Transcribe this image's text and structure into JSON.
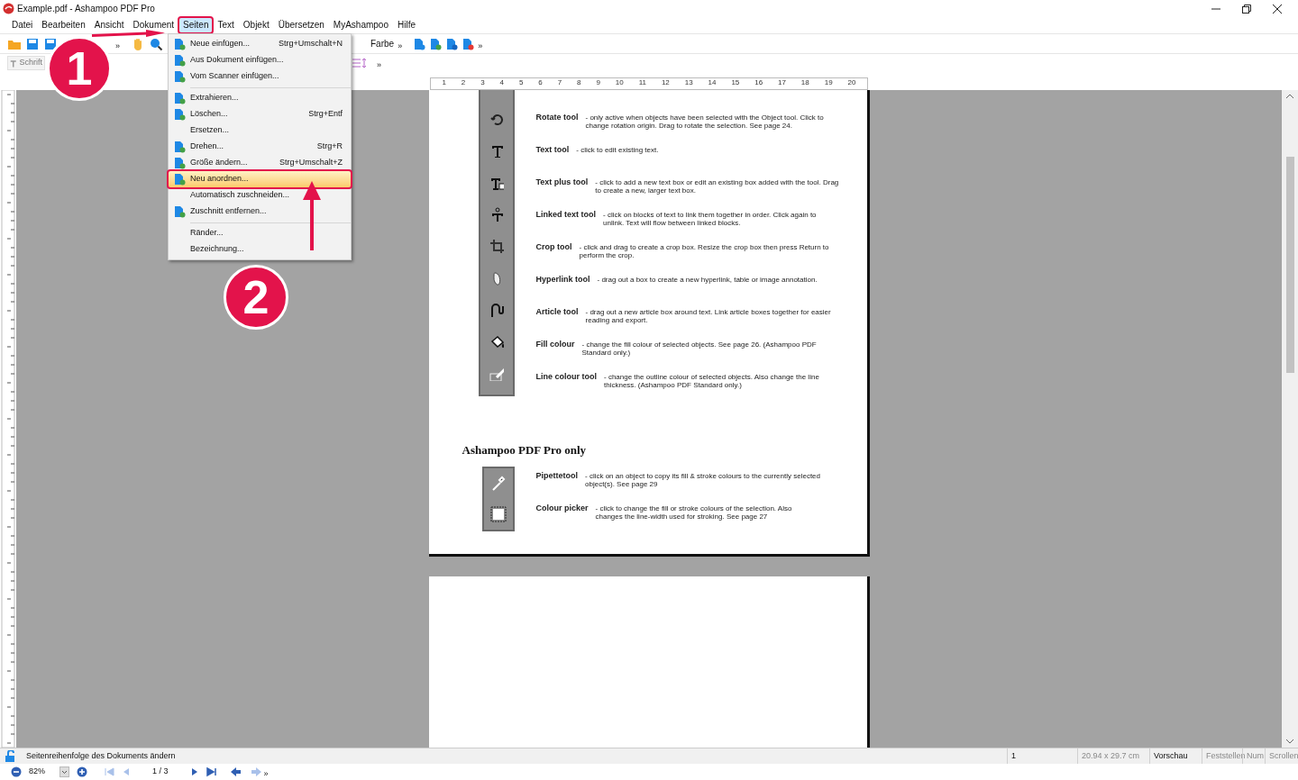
{
  "window": {
    "title": "Example.pdf - Ashampoo PDF Pro"
  },
  "menu_bar": [
    {
      "label": "Datei",
      "selected": false
    },
    {
      "label": "Bearbeiten",
      "selected": false
    },
    {
      "label": "Ansicht",
      "selected": false
    },
    {
      "label": "Dokument",
      "selected": false
    },
    {
      "label": "Seiten",
      "selected": true
    },
    {
      "label": "Text",
      "selected": false
    },
    {
      "label": "Objekt",
      "selected": false
    },
    {
      "label": "Übersetzen",
      "selected": false
    },
    {
      "label": "MyAshampoo",
      "selected": false
    },
    {
      "label": "Hilfe",
      "selected": false
    }
  ],
  "toolbar_1": {
    "chevrons": [
      "»",
      "»",
      "»"
    ],
    "color_label": "Farbe"
  },
  "toolbar_2": {
    "font_field": "Schrift",
    "chevron": "»"
  },
  "dropdown_menu": [
    {
      "kind": "item",
      "label": "Neue einfügen...",
      "shortcut": "Strg+Umschalt+N",
      "icon": true,
      "highlighted": false
    },
    {
      "kind": "item",
      "label": "Aus Dokument einfügen...",
      "icon": true,
      "highlighted": false
    },
    {
      "kind": "item",
      "label": "Vom Scanner einfügen...",
      "icon": true,
      "highlighted": false
    },
    {
      "kind": "separator"
    },
    {
      "kind": "item",
      "label": "Extrahieren...",
      "icon": true,
      "highlighted": false
    },
    {
      "kind": "item",
      "label": "Löschen...",
      "shortcut": "Strg+Entf",
      "icon": true,
      "highlighted": false
    },
    {
      "kind": "item",
      "label": "Ersetzen...",
      "icon": false,
      "highlighted": false
    },
    {
      "kind": "item",
      "label": "Drehen...",
      "shortcut": "Strg+R",
      "icon": true,
      "highlighted": false
    },
    {
      "kind": "item",
      "label": "Größe ändern...",
      "shortcut": "Strg+Umschalt+Z",
      "icon": true,
      "highlighted": false
    },
    {
      "kind": "item",
      "label": "Neu anordnen...",
      "icon": true,
      "highlighted": true
    },
    {
      "kind": "item",
      "label": "Automatisch zuschneiden...",
      "icon": false,
      "highlighted": false
    },
    {
      "kind": "item",
      "label": "Zuschnitt entfernen...",
      "icon": true,
      "highlighted": false
    },
    {
      "kind": "separator"
    },
    {
      "kind": "item",
      "label": "Ränder...",
      "icon": false,
      "highlighted": false
    },
    {
      "kind": "item",
      "label": "Bezeichnung...",
      "icon": false,
      "highlighted": false
    }
  ],
  "annotations": [
    {
      "kind": "circle",
      "number": "1"
    },
    {
      "kind": "arrow"
    },
    {
      "kind": "circle",
      "number": "2"
    },
    {
      "kind": "arrow"
    }
  ],
  "ruler": {
    "labels": [
      "1",
      "2",
      "3",
      "4",
      "5",
      "6",
      "7",
      "8",
      "9",
      "10",
      "11",
      "12",
      "13",
      "14",
      "15",
      "16",
      "17",
      "18",
      "19",
      "20"
    ]
  },
  "document": {
    "tools": [
      {
        "name": "Rotate tool",
        "description": "- only active when objects have been selected with the Object tool. Click to change rotation origin. Drag to rotate the selection. See page 24."
      },
      {
        "name": "Text tool",
        "description": "- click to edit existing text."
      },
      {
        "name": "Text plus tool",
        "description": "- click to add a new text box or edit an existing box added with the tool. Drag to create a new, larger text box."
      },
      {
        "name": "Linked text tool",
        "description": "- click on blocks of text to link them together in order. Click again to unlink. Text will flow between linked blocks."
      },
      {
        "name": "Crop tool",
        "description": "- click and drag to create a crop box. Resize the crop box then press Return to perform the crop."
      },
      {
        "name": "Hyperlink tool",
        "description": "- drag out a box to create a new hyperlink, table or image annotation."
      },
      {
        "name": "Article tool",
        "description": "- drag out a new article box around text. Link article boxes together for easier reading and export."
      },
      {
        "name": "Fill colour",
        "description": "- change the fill colour of selected objects. See page 26. (Ashampoo PDF Standard only.)"
      },
      {
        "name": "Line colour tool",
        "description": "- change the outline colour of selected objects. Also change the line thickness. (Ashampoo PDF Standard only.)"
      }
    ],
    "heading": "Ashampoo PDF Pro only",
    "pro_tools": [
      {
        "name": "Pipettetool",
        "description": "- click on an object to copy its fill & stroke colours to the currently selected object(s). See page 29"
      },
      {
        "name": "Colour picker",
        "description": "- click to change the fill or stroke colours of the selection. Also changes the line-width used for stroking. See page 27"
      }
    ]
  },
  "status_bar": {
    "message": "Seitenreihenfolge des Dokuments ändern",
    "cells": [
      {
        "text": "1",
        "enabled": true
      },
      {
        "text": "20.94 x 29.7 cm",
        "enabled": false
      },
      {
        "text": "Vorschau",
        "enabled": true
      },
      {
        "text": "Feststellen",
        "enabled": false
      },
      {
        "text": "Num",
        "enabled": false
      },
      {
        "text": "Scrollen",
        "enabled": false
      }
    ]
  },
  "navigation": {
    "zoom": "82%",
    "page": "1 / 3",
    "chevron": "»"
  }
}
